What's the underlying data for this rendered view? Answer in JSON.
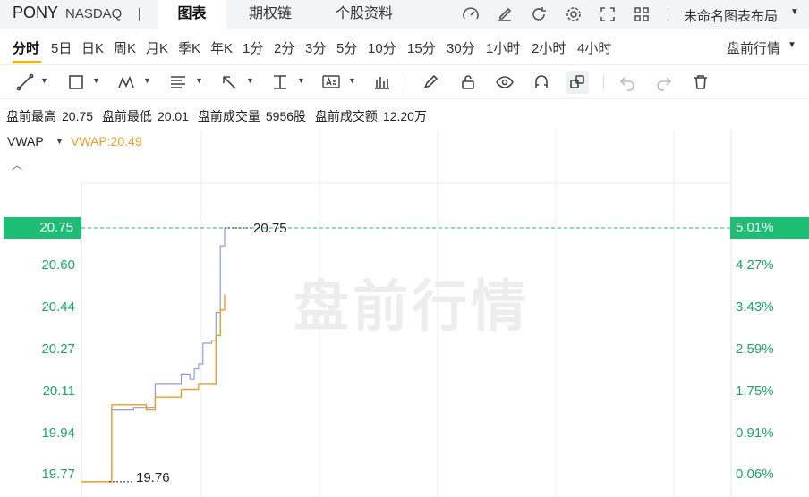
{
  "header": {
    "ticker": "PONY",
    "exchange": "NASDAQ",
    "tabs": [
      {
        "label": "图表",
        "active": true
      },
      {
        "label": "期权链",
        "active": false
      },
      {
        "label": "个股资料",
        "active": false
      }
    ],
    "icons": [
      "speedometer-icon",
      "edit-icon",
      "refresh-icon",
      "settings-icon",
      "fullscreen-icon",
      "grid-layout-icon"
    ],
    "layout_name": "未命名图表布局"
  },
  "periods": {
    "items": [
      "分时",
      "5日",
      "日K",
      "周K",
      "月K",
      "季K",
      "年K",
      "1分",
      "2分",
      "3分",
      "5分",
      "10分",
      "15分",
      "30分",
      "1小时",
      "2小时",
      "4小时"
    ],
    "active": "分时",
    "session": "盘前行情"
  },
  "toolbar": {
    "tools": [
      "line-tool-icon",
      "rectangle-tool-icon",
      "pattern-tool-icon",
      "fibonacci-tool-icon",
      "arrow-tool-icon",
      "measure-tool-icon",
      "text-tool-icon",
      "indicator-icon",
      "pencil-icon",
      "lock-icon",
      "eye-icon",
      "magnet-icon",
      "link-icon",
      "undo-icon",
      "redo-icon",
      "trash-icon"
    ]
  },
  "info": {
    "high_label": "盘前最高",
    "high": "20.75",
    "low_label": "盘前最低",
    "low": "20.01",
    "volume_label": "盘前成交量",
    "volume": "5956股",
    "amount_label": "盘前成交额",
    "amount": "12.20万"
  },
  "indicator": {
    "name": "VWAP",
    "value_text": "VWAP:20.49",
    "color": "#f29b1e"
  },
  "chart_data": {
    "type": "line",
    "watermark": "盘前行情",
    "y_ticks": [
      "20.60",
      "20.44",
      "20.27",
      "20.11",
      "19.94",
      "19.77"
    ],
    "pct_ticks": [
      "4.27%",
      "3.43%",
      "2.59%",
      "1.75%",
      "0.91%",
      "0.06%"
    ],
    "last_price": "20.75",
    "last_pct": "5.01%",
    "high_marker": "20.75",
    "low_marker": "19.76",
    "ylim": [
      19.75,
      21.5
    ],
    "price_series": [
      19.76,
      19.76,
      19.76,
      19.76,
      19.76,
      19.76,
      19.76,
      20.04,
      20.04,
      20.04,
      20.04,
      20.04,
      20.05,
      20.05,
      20.05,
      20.05,
      20.05,
      20.14,
      20.14,
      20.14,
      20.14,
      20.14,
      20.14,
      20.18,
      20.18,
      20.16,
      20.2,
      20.22,
      20.3,
      20.3,
      20.31,
      20.42,
      20.68,
      20.75
    ],
    "vwap_series": [
      19.76,
      19.76,
      19.76,
      19.76,
      19.76,
      19.76,
      19.76,
      20.06,
      20.06,
      20.06,
      20.06,
      20.06,
      20.06,
      20.06,
      20.06,
      20.04,
      20.04,
      20.09,
      20.09,
      20.09,
      20.09,
      20.09,
      20.09,
      20.12,
      20.12,
      20.12,
      20.12,
      20.14,
      20.14,
      20.14,
      20.14,
      20.33,
      20.43,
      20.49
    ],
    "price_color": "#8e9be8",
    "vwap_color": "#f29b1e",
    "up_color": "#1dbd75"
  }
}
